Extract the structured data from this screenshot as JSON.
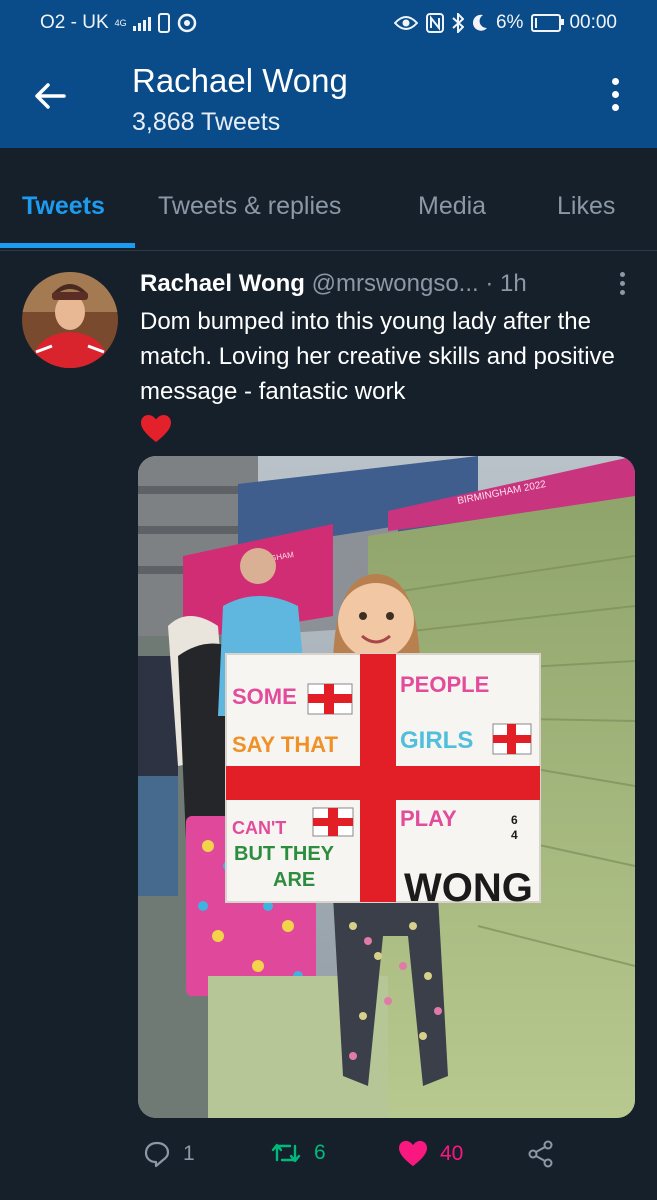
{
  "status_bar": {
    "carrier": "O2 - UK",
    "network": "4G",
    "battery": "6%",
    "battery_level": 0.06,
    "time": "00:00"
  },
  "header": {
    "title": "Rachael Wong",
    "subtitle": "3,868 Tweets",
    "back_icon": "arrow-left-icon",
    "more_icon": "more-vertical-icon"
  },
  "tabs": [
    {
      "label": "Tweets",
      "active": true
    },
    {
      "label": "Tweets & replies",
      "active": false
    },
    {
      "label": "Media",
      "active": false
    },
    {
      "label": "Likes",
      "active": false
    }
  ],
  "tweet": {
    "author_name": "Rachael Wong",
    "handle": "@mrswongso...",
    "separator": "·",
    "time": "1h",
    "text": "Dom bumped into this young lady after the match. Loving her creative skills and positive message - fantastic work",
    "emoji": "red-heart",
    "sign": {
      "top_left": "SOME",
      "top_right": "PEOPLE",
      "row2_left": "SAY THAT",
      "row2_right": "GIRLS",
      "row3_left": "CAN'T",
      "row3_right": "PLAY",
      "row4_left": "BUT THEY",
      "row5_left": "ARE",
      "bottom_right": "WONG",
      "score_top": "6",
      "score_bottom": "4"
    },
    "banner_text": "BIRMINGHAM 2022",
    "actions": {
      "replies": "1",
      "retweets": "6",
      "likes": "40"
    }
  },
  "colors": {
    "header_bg": "#0a4b8a",
    "page_bg": "#15202b",
    "accent": "#1d9bf0",
    "retweet": "#00ba7c",
    "like": "#f91880",
    "muted": "#8b98a5"
  }
}
